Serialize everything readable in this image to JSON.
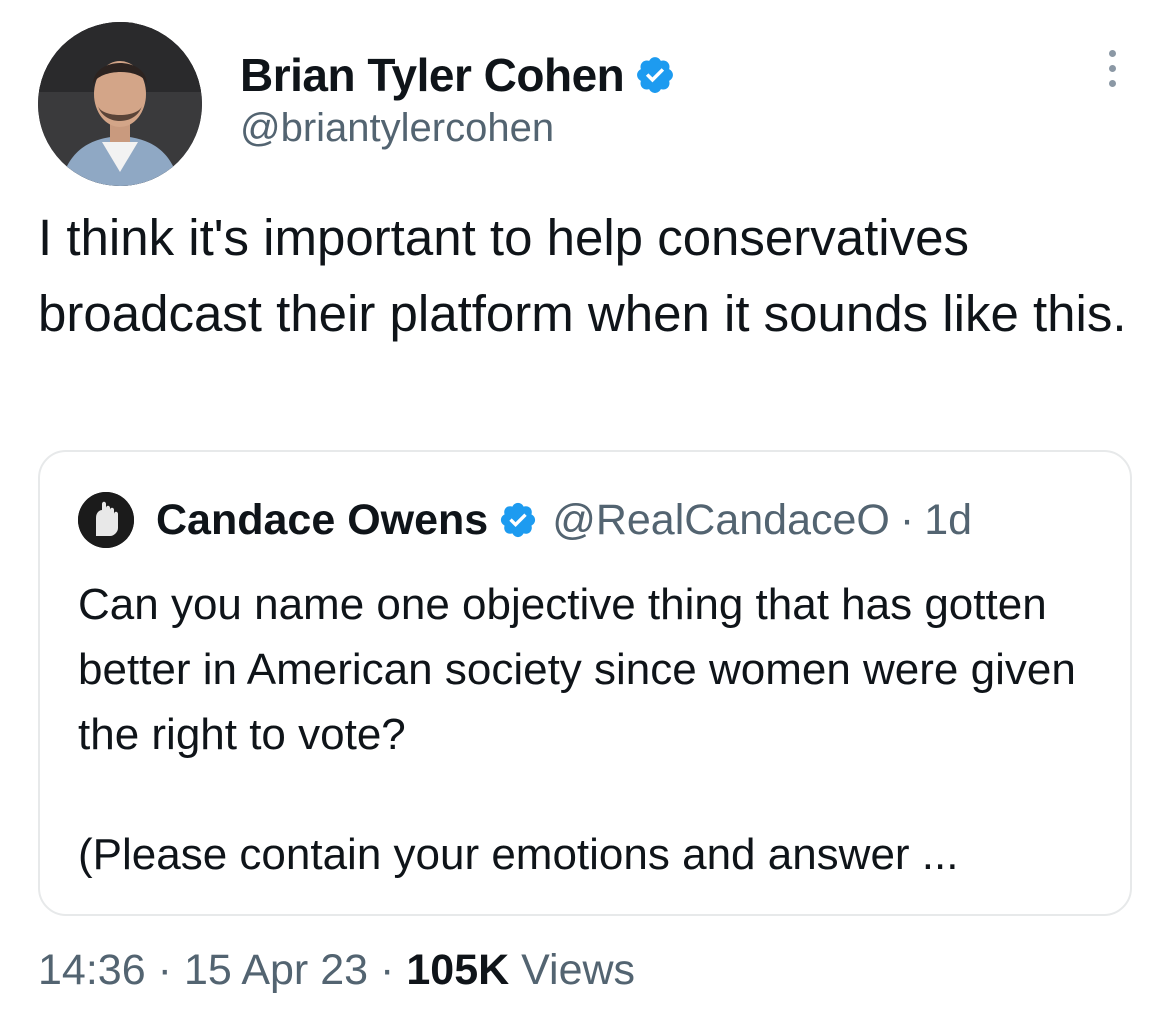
{
  "author": {
    "display_name": "Brian Tyler Cohen",
    "handle": "@briantylercohen",
    "verified": true
  },
  "tweet": {
    "text": "I think it's important to help conservatives broadcast their platform when it sounds like this."
  },
  "quoted_tweet": {
    "display_name": "Candace Owens",
    "handle": "@RealCandaceO",
    "separator": "·",
    "relative_time": "1d",
    "text": "Can you name one objective thing that has gotten better in American society since women were given the right to vote?",
    "continuation": "(Please contain your emotions and answer ..."
  },
  "meta": {
    "time": "14:36",
    "date": "15 Apr 23",
    "views_count": "105K",
    "views_label": "Views",
    "separator": "·"
  },
  "colors": {
    "text_primary": "#0f1419",
    "text_secondary": "#536471",
    "verified_blue": "#1d9bf0",
    "border": "#e7e9ea"
  },
  "icons": [
    "verified-badge-icon",
    "more-options-icon"
  ]
}
